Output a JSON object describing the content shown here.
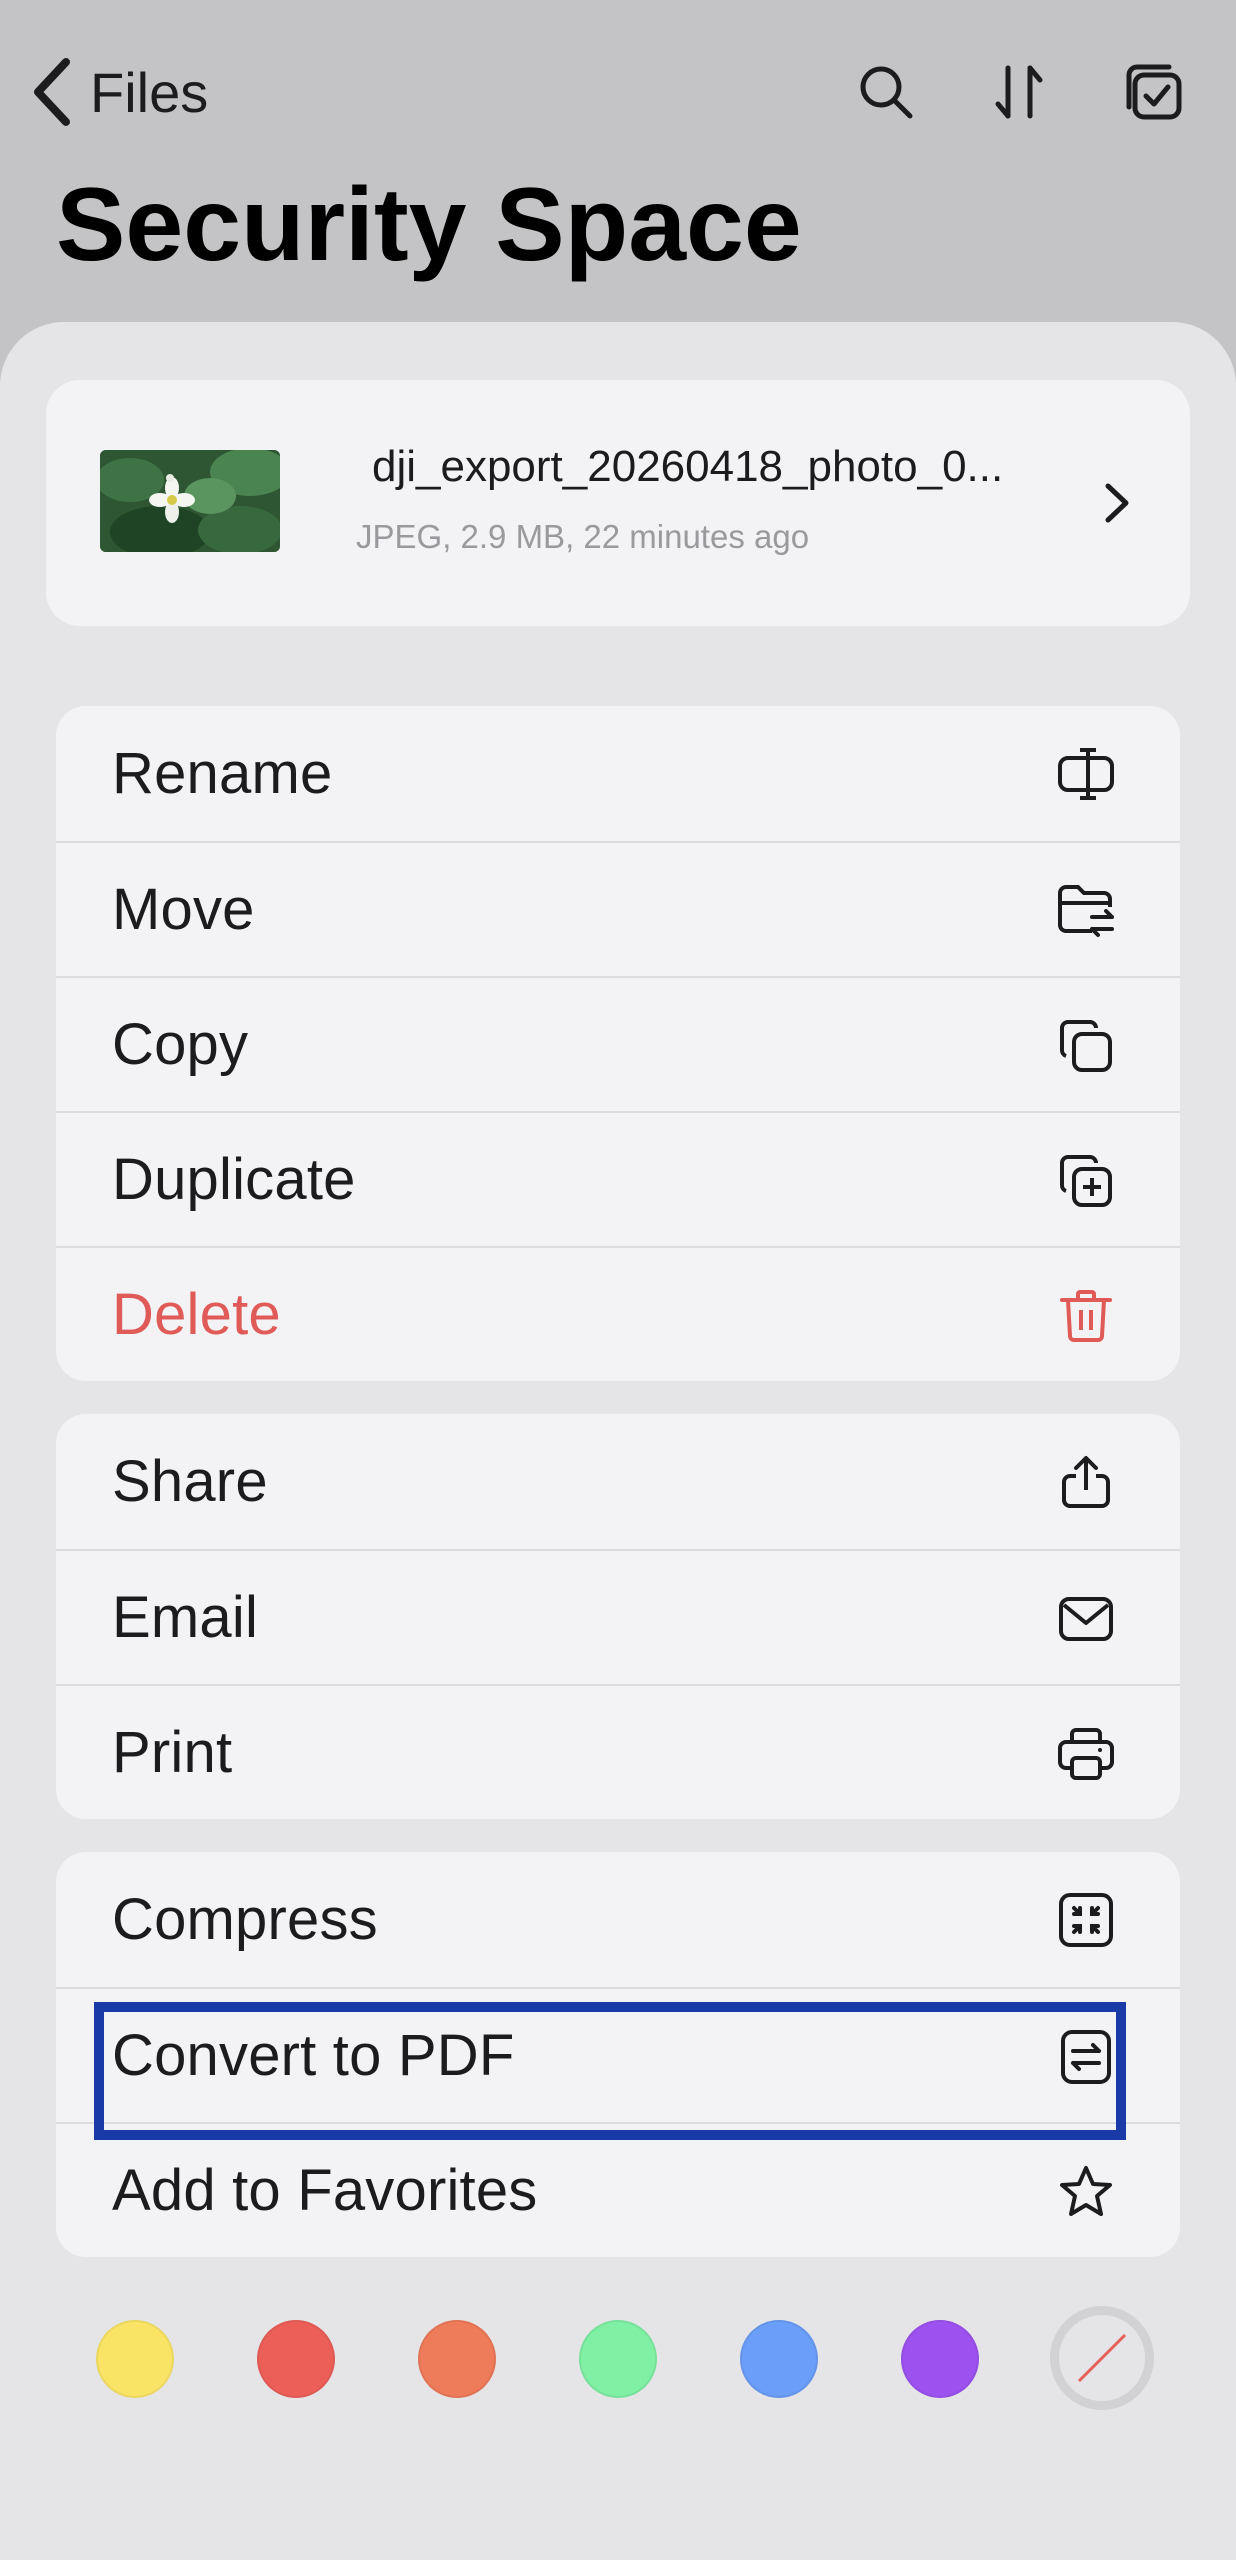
{
  "header": {
    "back_label": "Files",
    "title": "Security Space",
    "icons": [
      "search-icon",
      "sort-icon",
      "select-icon"
    ]
  },
  "file": {
    "name": "dji_export_20260418_photo_0...",
    "meta": "JPEG, 2.9 MB, 22 minutes ago"
  },
  "groups": [
    {
      "items": [
        {
          "key": "rename",
          "label": "Rename",
          "icon": "rename-icon"
        },
        {
          "key": "move",
          "label": "Move",
          "icon": "folder-move-icon"
        },
        {
          "key": "copy",
          "label": "Copy",
          "icon": "copy-icon"
        },
        {
          "key": "duplicate",
          "label": "Duplicate",
          "icon": "duplicate-icon"
        },
        {
          "key": "delete",
          "label": "Delete",
          "icon": "trash-icon",
          "danger": true
        }
      ]
    },
    {
      "items": [
        {
          "key": "share",
          "label": "Share",
          "icon": "share-icon"
        },
        {
          "key": "email",
          "label": "Email",
          "icon": "envelope-icon"
        },
        {
          "key": "print",
          "label": "Print",
          "icon": "printer-icon"
        }
      ]
    },
    {
      "items": [
        {
          "key": "compress",
          "label": "Compress",
          "icon": "compress-icon"
        },
        {
          "key": "convert",
          "label": "Convert to PDF",
          "icon": "convert-icon"
        },
        {
          "key": "favorites",
          "label": "Add to Favorites",
          "icon": "star-icon"
        }
      ]
    }
  ],
  "colors": {
    "danger": "#e05a57",
    "highlight": "#1a3aa8",
    "tags": [
      "#fae466",
      "#ec5f59",
      "#ee7b59",
      "#7ff0a4",
      "#6b9ef8",
      "#9d52f0"
    ],
    "none_tag": "no-color-icon"
  }
}
